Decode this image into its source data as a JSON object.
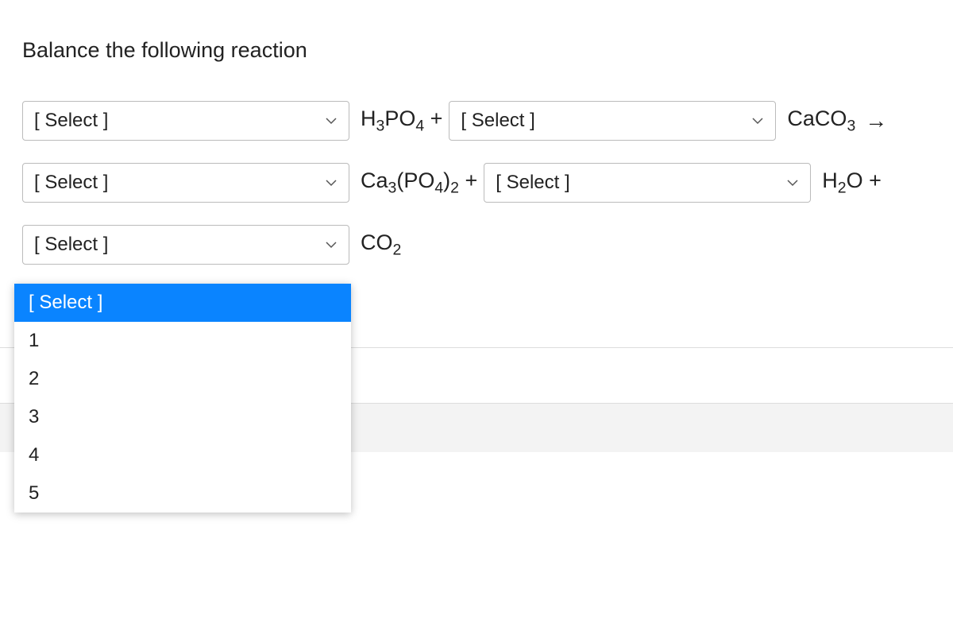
{
  "prompt": "Balance the following reaction",
  "select_placeholder": "[ Select ]",
  "formulas": {
    "h3po4_plus": "H₃PO₄ +",
    "caco3": "CaCO₃",
    "ca3po42_plus": "Ca₃(PO₄)₂ +",
    "h2o_plus": "H₂O +",
    "co2": "CO₂"
  },
  "dropdown": {
    "options": [
      "[ Select ]",
      "1",
      "2",
      "3",
      "4",
      "5"
    ],
    "selected": "[ Select ]"
  }
}
